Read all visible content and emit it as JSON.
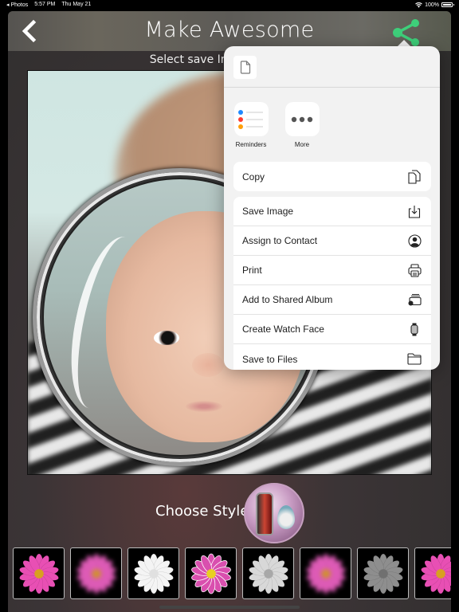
{
  "status_bar": {
    "back_app": "◂ Photos",
    "time": "5:57 PM",
    "date": "Thu May 21",
    "battery": "100%"
  },
  "navbar": {
    "title": "Make Awesome",
    "back_icon": "chevron-left-icon",
    "share_icon": "share-icon",
    "accent_color": "#3ecf7a"
  },
  "subtitle": "Select save Image s",
  "editor": {
    "frame_style": "mirror",
    "photo_subject": "baby"
  },
  "style_picker": {
    "label": "Choose Style"
  },
  "filters": [
    {
      "name": "original",
      "tone": "pink"
    },
    {
      "name": "blur",
      "tone": "pink-blur"
    },
    {
      "name": "white",
      "tone": "white"
    },
    {
      "name": "sketch-color",
      "tone": "pink-sketch"
    },
    {
      "name": "light-gray",
      "tone": "lightgray"
    },
    {
      "name": "soft-blur",
      "tone": "pink-blur"
    },
    {
      "name": "grayscale",
      "tone": "gray"
    },
    {
      "name": "vivid",
      "tone": "pink"
    }
  ],
  "share_sheet": {
    "header_icon": "document-icon",
    "apps": [
      {
        "label": "Reminders",
        "icon": "reminders-icon"
      },
      {
        "label": "More",
        "icon": "more-icon"
      }
    ],
    "primary_actions": [
      {
        "label": "Copy",
        "icon": "copy-icon"
      }
    ],
    "actions": [
      {
        "label": "Save Image",
        "icon": "save-image-icon"
      },
      {
        "label": "Assign to Contact",
        "icon": "contact-icon"
      },
      {
        "label": "Print",
        "icon": "printer-icon"
      },
      {
        "label": "Add to Shared Album",
        "icon": "shared-album-icon"
      },
      {
        "label": "Create Watch Face",
        "icon": "watch-icon"
      },
      {
        "label": "Save to Files",
        "icon": "folder-icon"
      }
    ]
  }
}
